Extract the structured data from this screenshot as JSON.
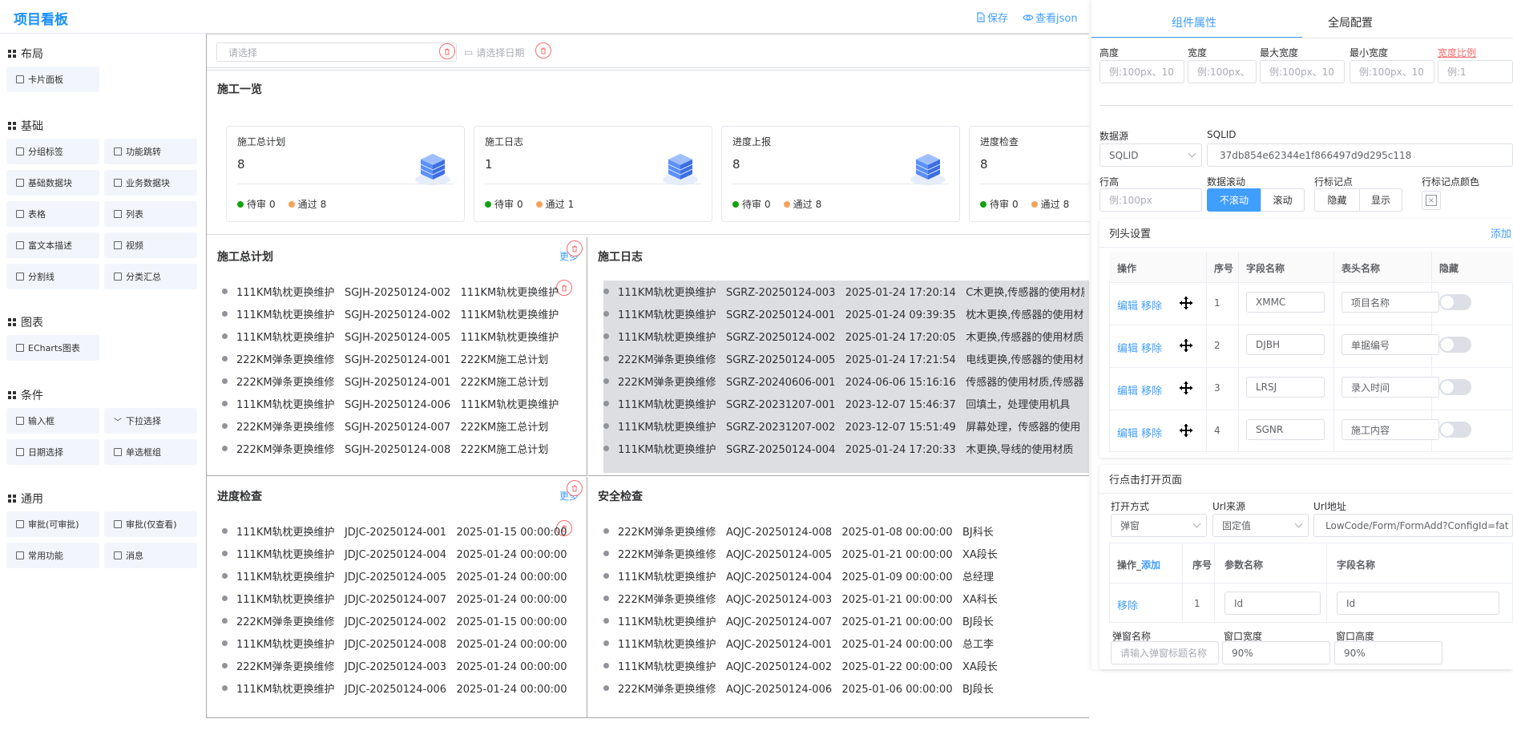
{
  "header": {
    "title": "项目看板",
    "save_label": "保存",
    "view_json_label": "查看json"
  },
  "sidebar": {
    "groups": [
      {
        "title": "布局",
        "items": [
          "卡片面板"
        ]
      },
      {
        "title": "基础",
        "items": [
          "分组标签",
          "功能跳转",
          "基础数据块",
          "业务数据块",
          "表格",
          "列表",
          "富文本描述",
          "视频",
          "分割线",
          "分类汇总"
        ]
      },
      {
        "title": "图表",
        "items": [
          "ECharts图表"
        ]
      },
      {
        "title": "条件",
        "items": [
          "输入框",
          "下拉选择",
          "日期选择",
          "单选框组"
        ]
      },
      {
        "title": "通用",
        "items": [
          "审批(可审批)",
          "审批(仅查看)",
          "常用功能",
          "消息"
        ]
      }
    ]
  },
  "filters": {
    "select_placeholder": "请选择",
    "date_placeholder": "请选择日期"
  },
  "overview": {
    "title": "施工一览",
    "cards": [
      {
        "title": "施工总计划",
        "count": "8",
        "pending_label": "待审",
        "pending": "0",
        "passed_label": "通过",
        "passed": "8"
      },
      {
        "title": "施工日志",
        "count": "1",
        "pending_label": "待审",
        "pending": "0",
        "passed_label": "通过",
        "passed": "1"
      },
      {
        "title": "进度上报",
        "count": "8",
        "pending_label": "待审",
        "pending": "0",
        "passed_label": "通过",
        "passed": "8"
      },
      {
        "title": "进度检查",
        "count": "8",
        "pending_label": "待审",
        "pending": "0",
        "passed_label": "通过",
        "passed": "8"
      }
    ]
  },
  "panels": {
    "plan": {
      "title": "施工总计划",
      "more": "更多",
      "rows": [
        "111KM轨枕更换维护   SGJH-20250124-002   111KM轨枕更换维护",
        "111KM轨枕更换维护   SGJH-20250124-002   111KM轨枕更换维护",
        "111KM轨枕更换维护   SGJH-20250124-005   111KM轨枕更换维护",
        "222KM弹条更换维修   SGJH-20250124-001   222KM施工总计划",
        "222KM弹条更换维修   SGJH-20250124-001   222KM施工总计划",
        "111KM轨枕更换维护   SGJH-20250124-006   111KM轨枕更换维护",
        "222KM弹条更换维修   SGJH-20250124-007   222KM施工总计划",
        "222KM弹条更换维修   SGJH-20250124-008   222KM施工总计划"
      ]
    },
    "log": {
      "title": "施工日志",
      "rows": [
        "111KM轨枕更换维护   SGRZ-20250124-003   2025-01-24 17:20:14   C木更换,传感器的使用材质",
        "111KM轨枕更换维护   SGRZ-20250124-001   2025-01-24 09:39:35   枕木更换,传感器的使用材质",
        "111KM轨枕更换维护   SGRZ-20250124-002   2025-01-24 17:20:05   木更换,传感器的使用材质",
        "222KM弹条更换维修   SGRZ-20250124-005   2025-01-24 17:21:54   电线更换,传感器的使用材",
        "222KM弹条更换维修   SGRZ-20240606-001   2024-06-06 15:16:16   传感器的使用材质,传感器",
        "111KM轨枕更换维护   SGRZ-20231207-001   2023-12-07 15:46:37   回填土，处理使用机具",
        "111KM轨枕更换维护   SGRZ-20231207-002   2023-12-07 15:51:49   屏幕处理，传感器的使用",
        "111KM轨枕更换维护   SGRZ-20250124-004   2025-01-24 17:20:33   木更换,导线的使用材质"
      ]
    },
    "progress": {
      "title": "进度检查",
      "more": "更多",
      "rows": [
        "111KM轨枕更换维护   JDJC-20250124-001   2025-01-15 00:00:00",
        "111KM轨枕更换维护   JDJC-20250124-004   2025-01-24 00:00:00",
        "111KM轨枕更换维护   JDJC-20250124-005   2025-01-24 00:00:00",
        "111KM轨枕更换维护   JDJC-20250124-007   2025-01-24 00:00:00",
        "222KM弹条更换维修   JDJC-20250124-002   2025-01-15 00:00:00",
        "111KM轨枕更换维护   JDJC-20250124-008   2025-01-24 00:00:00",
        "222KM弹条更换维修   JDJC-20250124-003   2025-01-24 00:00:00",
        "111KM轨枕更换维护   JDJC-20250124-006   2025-01-24 00:00:00"
      ]
    },
    "safety": {
      "title": "安全检查",
      "rows": [
        "222KM弹条更换维修   AQJC-20250124-008   2025-01-08 00:00:00   BJ科长",
        "222KM弹条更换维修   AQJC-20250124-005   2025-01-21 00:00:00   XA段长",
        "111KM轨枕更换维护   AQJC-20250124-004   2025-01-09 00:00:00   总经理",
        "222KM弹条更换维修   AQJC-20250124-003   2025-01-21 00:00:00   XA科长",
        "111KM轨枕更换维护   AQJC-20250124-007   2025-01-21 00:00:00   BJ段长",
        "111KM轨枕更换维护   AQJC-20250124-001   2025-01-24 00:00:00   总工李",
        "111KM轨枕更换维护   AQJC-20250124-002   2025-01-22 00:00:00   XA段长",
        "222KM弹条更换维修   AQJC-20250124-006   2025-01-06 00:00:00   BJ段长"
      ]
    }
  },
  "props": {
    "tabs": [
      "组件属性",
      "全局配置"
    ],
    "size_labels": {
      "height": "高度",
      "width": "宽度",
      "max_width": "最大宽度",
      "min_width": "最小宽度",
      "ratio": "宽度比例"
    },
    "size_placeholders": {
      "height": "例:100px、10",
      "width": "例:100px、",
      "max_width": "例:100px、10",
      "min_width": "例:100px、10",
      "ratio": "例:1"
    },
    "datasource_label": "数据源",
    "datasource_value": "SQLID",
    "sqlid_label": "SQLID",
    "sqlid_value": "37db854e62344e1f866497d9d295c118",
    "row_height_label": "行高",
    "row_height_placeholder": "例:100px",
    "scroll_label": "数据滚动",
    "scroll_options": [
      "不滚动",
      "滚动"
    ],
    "marker_label": "行标记点",
    "marker_options": [
      "隐藏",
      "显示"
    ],
    "marker_color_label": "行标记点颜色",
    "column_settings": {
      "title": "列头设置",
      "add": "添加",
      "headers": [
        "操作",
        "序号",
        "字段名称",
        "表头名称",
        "隐藏"
      ],
      "edit": "编辑",
      "remove": "移除",
      "rows": [
        {
          "index": "1",
          "field": "XMMC",
          "name": "项目名称"
        },
        {
          "index": "2",
          "field": "DJBH",
          "name": "单据编号"
        },
        {
          "index": "3",
          "field": "LRSJ",
          "name": "录入时间"
        },
        {
          "index": "4",
          "field": "SGNR",
          "name": "施工内容"
        }
      ]
    },
    "row_click": {
      "title": "行点击打开页面",
      "open_label": "打开方式",
      "open_value": "弹窗",
      "url_source_label": "Url来源",
      "url_source_value": "固定值",
      "url_label": "Url地址",
      "url_value": "LowCode/Form/FormAdd?ConfigId=fat",
      "param_headers": [
        "操作_",
        "添加",
        "序号",
        "参数名称",
        "字段名称"
      ],
      "param_row": {
        "action": "移除",
        "index": "1",
        "param": "Id",
        "field": "Id"
      },
      "popup_name_label": "弹窗名称",
      "popup_name_placeholder": "请输入弹窗标题名称",
      "win_width_label": "窗口宽度",
      "win_width": "90%",
      "win_height_label": "窗口高度",
      "win_height": "90%"
    }
  },
  "colors": {
    "accent": "#409eff",
    "title": "#1890ff",
    "pending": "#13a10e",
    "passed": "#f7a35c",
    "danger": "#f56c6c"
  }
}
